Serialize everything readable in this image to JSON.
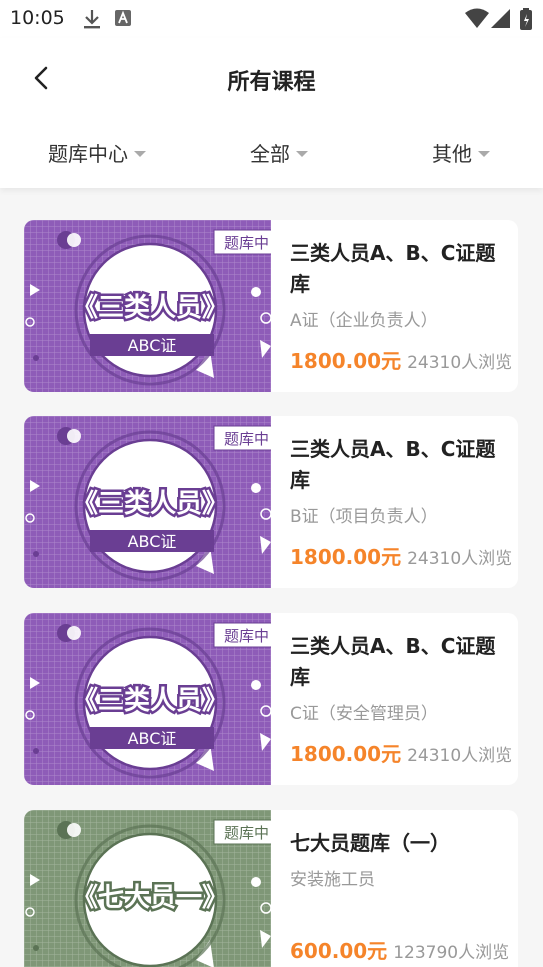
{
  "status": {
    "time": "10:05"
  },
  "header": {
    "title": "所有课程"
  },
  "filters": [
    {
      "label": "题库中心"
    },
    {
      "label": "全部"
    },
    {
      "label": "其他"
    }
  ],
  "courses": [
    {
      "title": "三类人员A、B、C证题库",
      "subtitle": "A证（企业负责人）",
      "price": "1800.00元",
      "views": "24310人浏览",
      "thumb": {
        "tag": "题库中",
        "main": "《三类人员》",
        "band": "ABC证",
        "color": "#8e5cb8",
        "dark": "#6a3e93"
      }
    },
    {
      "title": "三类人员A、B、C证题库",
      "subtitle": "B证（项目负责人）",
      "price": "1800.00元",
      "views": "24310人浏览",
      "thumb": {
        "tag": "题库中",
        "main": "《三类人员》",
        "band": "ABC证",
        "color": "#8e5cb8",
        "dark": "#6a3e93"
      }
    },
    {
      "title": "三类人员A、B、C证题库",
      "subtitle": "C证（安全管理员）",
      "price": "1800.00元",
      "views": "24310人浏览",
      "thumb": {
        "tag": "题库中",
        "main": "《三类人员》",
        "band": "ABC证",
        "color": "#8e5cb8",
        "dark": "#6a3e93"
      }
    },
    {
      "title": "七大员题库（一）",
      "subtitle": "安装施工员",
      "price": "600.00元",
      "views": "123790人浏览",
      "thumb": {
        "tag": "题库中",
        "main": "《七大员一》",
        "band": "",
        "color": "#7f9777",
        "dark": "#5b7355"
      }
    }
  ]
}
